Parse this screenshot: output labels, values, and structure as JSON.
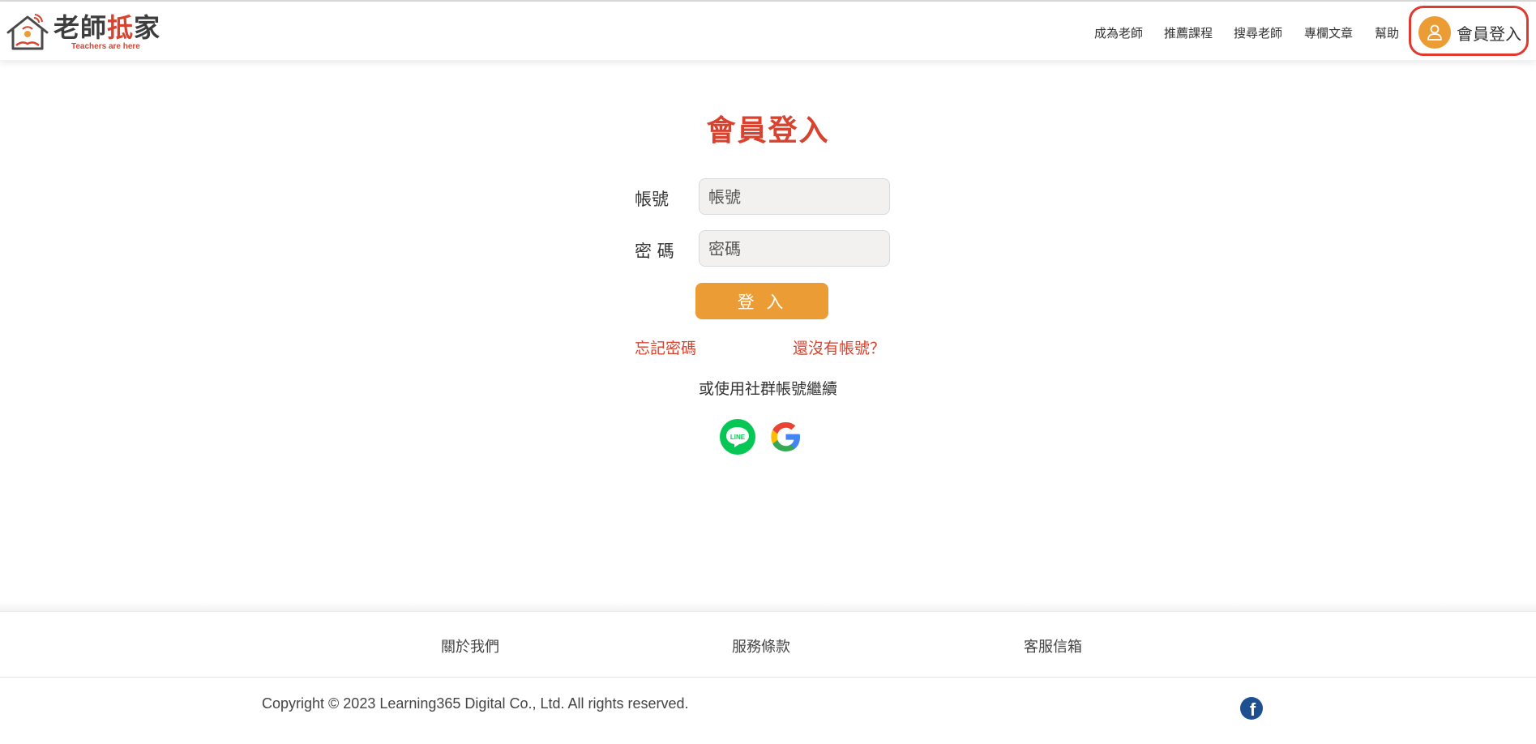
{
  "header": {
    "logo": {
      "title_part1": "老師",
      "title_part2": "抵",
      "title_part3": "家",
      "slogan": "Teachers are here"
    },
    "nav": [
      {
        "label": "成為老師"
      },
      {
        "label": "推薦課程"
      },
      {
        "label": "搜尋老師"
      },
      {
        "label": "專欄文章"
      },
      {
        "label": "幫助"
      }
    ],
    "login_button": {
      "label": "會員登入",
      "icon": "user-icon"
    }
  },
  "login_form": {
    "title": "會員登入",
    "account": {
      "label": "帳號",
      "placeholder": "帳號",
      "value": ""
    },
    "password": {
      "label": "密 碼",
      "placeholder": "密碼",
      "value": ""
    },
    "submit_label": "登 入",
    "forgot_password": "忘記密碼",
    "register": "還沒有帳號？",
    "social_prompt": "或使用社群帳號繼續",
    "social": [
      {
        "name": "line-icon",
        "text": "LINE",
        "color": "#06c755"
      },
      {
        "name": "google-icon"
      }
    ]
  },
  "footer": {
    "links": [
      {
        "label": "關於我們"
      },
      {
        "label": "服務條款"
      },
      {
        "label": "客服信箱"
      }
    ],
    "copyright": "Copyright © 2023 Learning365 Digital Co., Ltd. All rights reserved.",
    "facebook_icon": "facebook-icon"
  },
  "colors": {
    "accent_red": "#d8432f",
    "accent_orange": "#ec9c34",
    "login_highlight": "#e03a2e",
    "facebook_blue": "#1d4f91"
  }
}
